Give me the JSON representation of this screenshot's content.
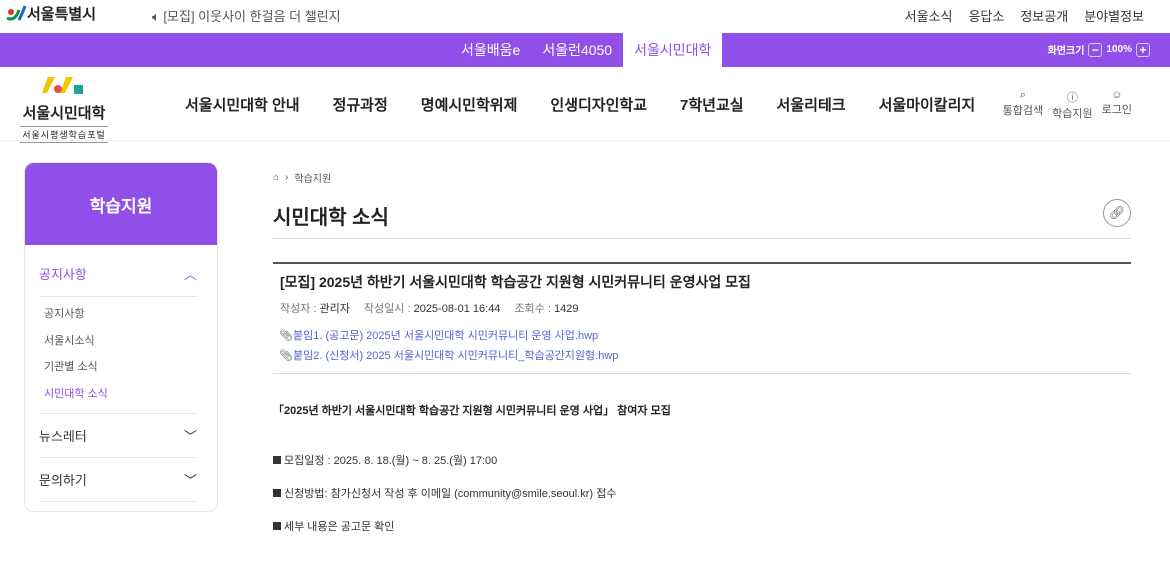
{
  "top": {
    "brand": "서울특별시",
    "notice": "[모집] 이웃사이 한걸음 더 챌린지",
    "links": [
      "서울소식",
      "응답소",
      "정보공개",
      "분야별정보"
    ]
  },
  "purple_bar": {
    "tabs": [
      "서울배움e",
      "서울런4050",
      "서울시민대학"
    ],
    "active": "서울시민대학",
    "zoom_label": "화면크기",
    "zoom_value": "100%",
    "zoom_minus": "−",
    "zoom_plus": "+"
  },
  "header": {
    "logo_title": "서울시민대학",
    "logo_sub": "서울시평생학습포털",
    "nav": [
      "서울시민대학 안내",
      "정규과정",
      "명예시민학위제",
      "인생디자인학교",
      "7학년교실",
      "서울리테크",
      "서울마이칼리지"
    ],
    "util": [
      {
        "icon": "search-icon",
        "label": "통합검색"
      },
      {
        "icon": "info-icon",
        "label": "학습지원"
      },
      {
        "icon": "user-icon",
        "label": "로그인"
      }
    ]
  },
  "sidebar": {
    "title": "학습지원",
    "open_section": "공지사항",
    "sub_items": [
      "공지사항",
      "서울시소식",
      "기관별 소식",
      "시민대학 소식"
    ],
    "active_sub": "시민대학 소식",
    "sections": [
      "뉴스레터",
      "문의하기"
    ]
  },
  "breadcrumb": [
    "학습지원"
  ],
  "page_title": "시민대학 소식",
  "article": {
    "title": "[모집] 2025년 하반기 서울시민대학 학습공간 지원형 시민커뮤니티 운영사업 모집",
    "author_label": "작성자 :",
    "author": "관리자",
    "date_label": "작성일시 :",
    "date": "2025-08-01 16:44",
    "views_label": "조회수 :",
    "views": "1429",
    "attachments": [
      "붙임1. (공고문) 2025년 서울시민대학 시민커뮤니티 운영 사업.hwp",
      "붙임2. (신청서) 2025 서울시민대학 시민커뮤니티_학습공간지원형.hwp"
    ],
    "heading": "「2025년 하반기 서울시민대학 학습공간 지원형 시민커뮤니티 운영 사업」 참여자 모집",
    "bullets": [
      "모집일정 : 2025. 8. 18.(월) ~ 8. 25.(월) 17:00",
      "신청방법: 참가신청서 작성 후 이메일 (community@smile.seoul.kr) 접수",
      "세부 내용은 공고문 확인"
    ]
  },
  "colors": {
    "accent": "#8f4fe8",
    "link": "#5561d6"
  }
}
